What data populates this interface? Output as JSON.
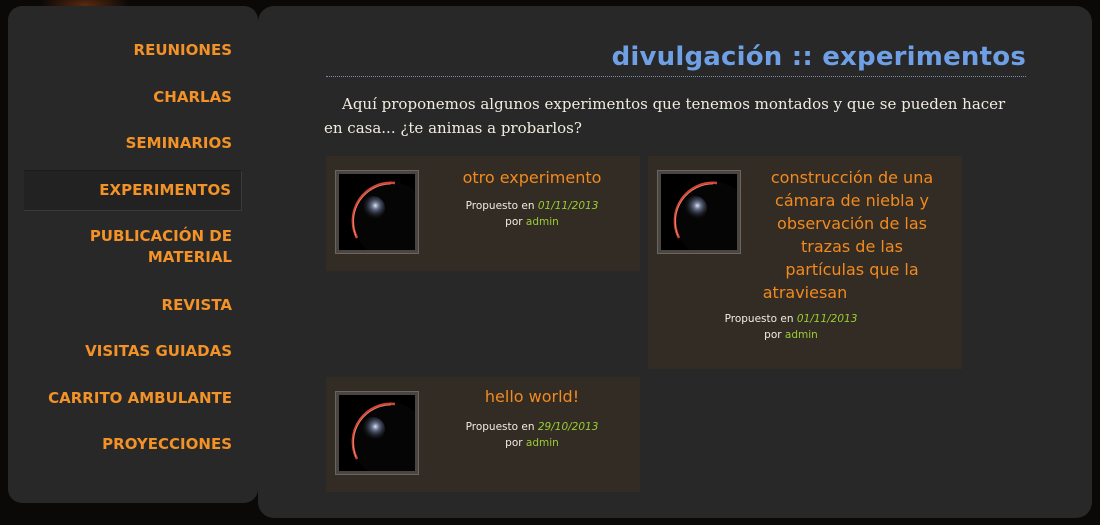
{
  "sidebar": {
    "items": [
      {
        "label": "REUNIONES"
      },
      {
        "label": "CHARLAS"
      },
      {
        "label": "SEMINARIOS"
      },
      {
        "label": "EXPERIMENTOS"
      },
      {
        "label_line1": "PUBLICACIÓN DE",
        "label_line2": "MATERIAL"
      },
      {
        "label": "REVISTA"
      },
      {
        "label": "VISITAS GUIADAS"
      },
      {
        "label": "CARRITO AMBULANTE"
      },
      {
        "label": "PROYECCIONES"
      }
    ]
  },
  "main": {
    "title": "divulgación :: experimentos",
    "intro": "Aquí proponemos algunos experimentos que tenemos montados y que se pueden hacer en casa... ¿te animas a probarlos?",
    "posts": [
      {
        "title": "otro experimento",
        "posted_label": "Propuesto en",
        "date": "01/11/2013",
        "by_label": "por",
        "author": "admin"
      },
      {
        "title": "construcción de una cámara de niebla y observación de las trazas de las partículas que la atraviesan",
        "title_lines": [
          "construcción de una",
          "cámara de niebla y",
          "observación de las",
          "trazas de las",
          "partículas que la",
          "atraviesan"
        ],
        "posted_label": "Propuesto en",
        "date": "01/11/2013",
        "by_label": "por",
        "author": "admin"
      },
      {
        "title": "hello world!",
        "posted_label": "Propuesto en",
        "date": "29/10/2013",
        "by_label": "por",
        "author": "admin"
      }
    ]
  },
  "colors": {
    "accent": "#f29227",
    "title_blue": "#6fa0e6",
    "date_green": "#9acd32",
    "panel_bg": "#282828",
    "card_bg": "#332c25"
  }
}
